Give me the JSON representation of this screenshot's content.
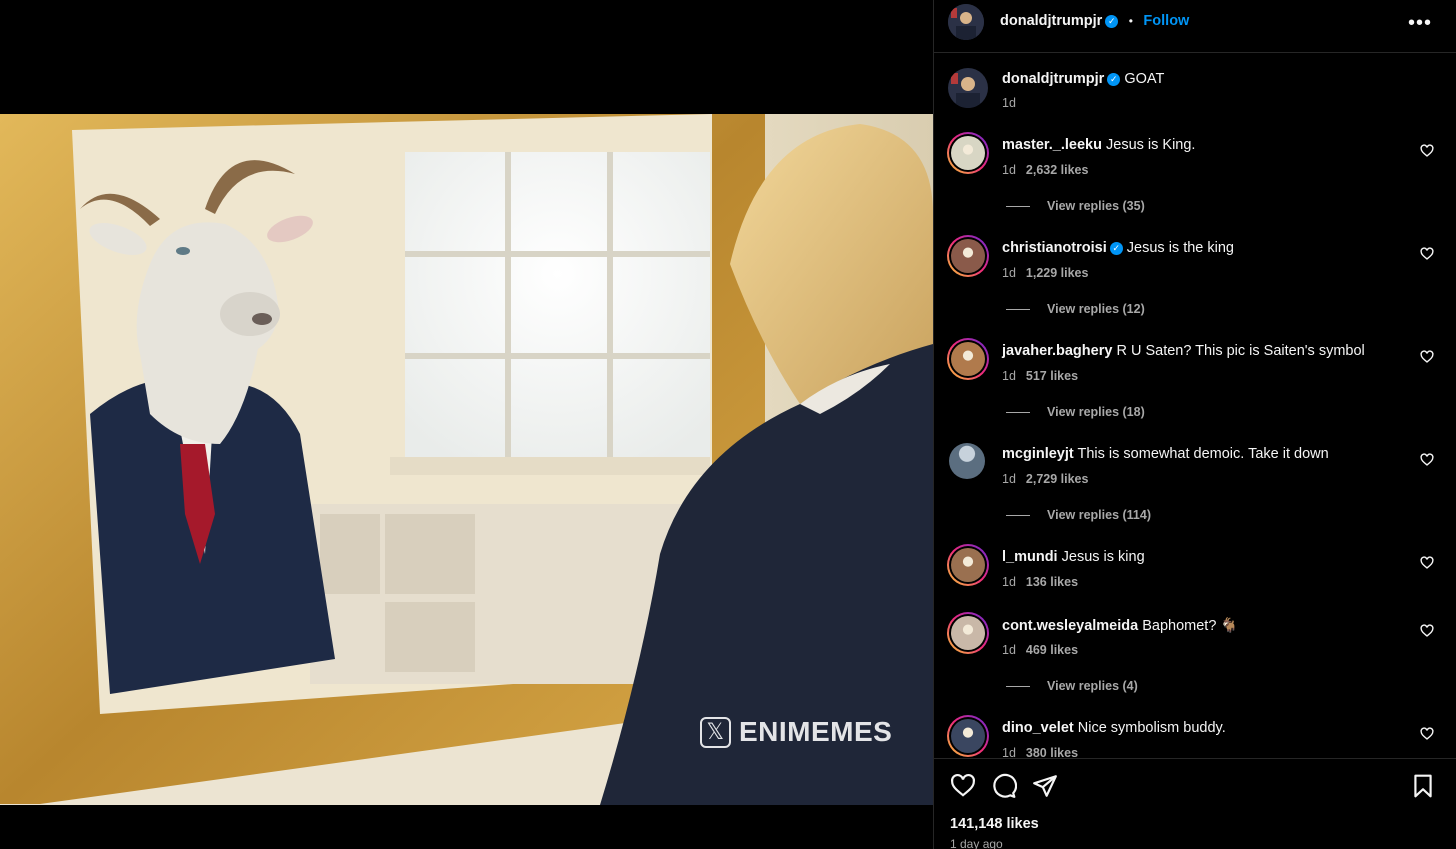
{
  "post": {
    "author": "donaldjtrumpjr",
    "verified": true,
    "follow_label": "Follow",
    "more_label": "•••",
    "caption": "GOAT",
    "caption_time": "1d",
    "watermark": "ENIMEMES",
    "watermark_icon": "𝕏"
  },
  "comments": [
    {
      "user": "master._.leeku",
      "verified": false,
      "text": "Jesus is King.",
      "time": "1d",
      "likes": "2,632 likes",
      "replies": "View replies (35)",
      "avatar_color": "#d8d6c4",
      "ring": true
    },
    {
      "user": "christianotroisi",
      "verified": true,
      "text": "Jesus is the king",
      "time": "1d",
      "likes": "1,229 likes",
      "replies": "View replies (12)",
      "avatar_color": "#8a5a4a",
      "ring": true
    },
    {
      "user": "javaher.baghery",
      "verified": false,
      "text": "R U Saten? This pic is Saiten's symbol",
      "time": "1d",
      "likes": "517 likes",
      "replies": "View replies (18)",
      "avatar_color": "#b07a4c",
      "ring": true
    },
    {
      "user": "mcginleyjt",
      "verified": false,
      "text": "This is somewhat demoic. Take it down",
      "time": "1d",
      "likes": "2,729 likes",
      "replies": "View replies (114)",
      "avatar_color": "#5b6e80",
      "ring": false
    },
    {
      "user": "l_mundi",
      "verified": false,
      "text": "Jesus is king",
      "time": "1d",
      "likes": "136 likes",
      "replies": "",
      "avatar_color": "#9a7050",
      "ring": true
    },
    {
      "user": "cont.wesleyalmeida",
      "verified": false,
      "text": "Baphomet? 🐐",
      "time": "1d",
      "likes": "469 likes",
      "replies": "View replies (4)",
      "avatar_color": "#c9b8a8",
      "ring": true
    },
    {
      "user": "dino_velet",
      "verified": false,
      "text": "Nice symbolism buddy.",
      "time": "1d",
      "likes": "380 likes",
      "replies": "",
      "avatar_color": "#3a4660",
      "ring": true
    }
  ],
  "footer": {
    "likes": "141,148 likes",
    "time": "1 day ago"
  },
  "colors": {
    "accent": "#0095f6",
    "muted_text": "#a8a8a8",
    "border": "#262626"
  }
}
